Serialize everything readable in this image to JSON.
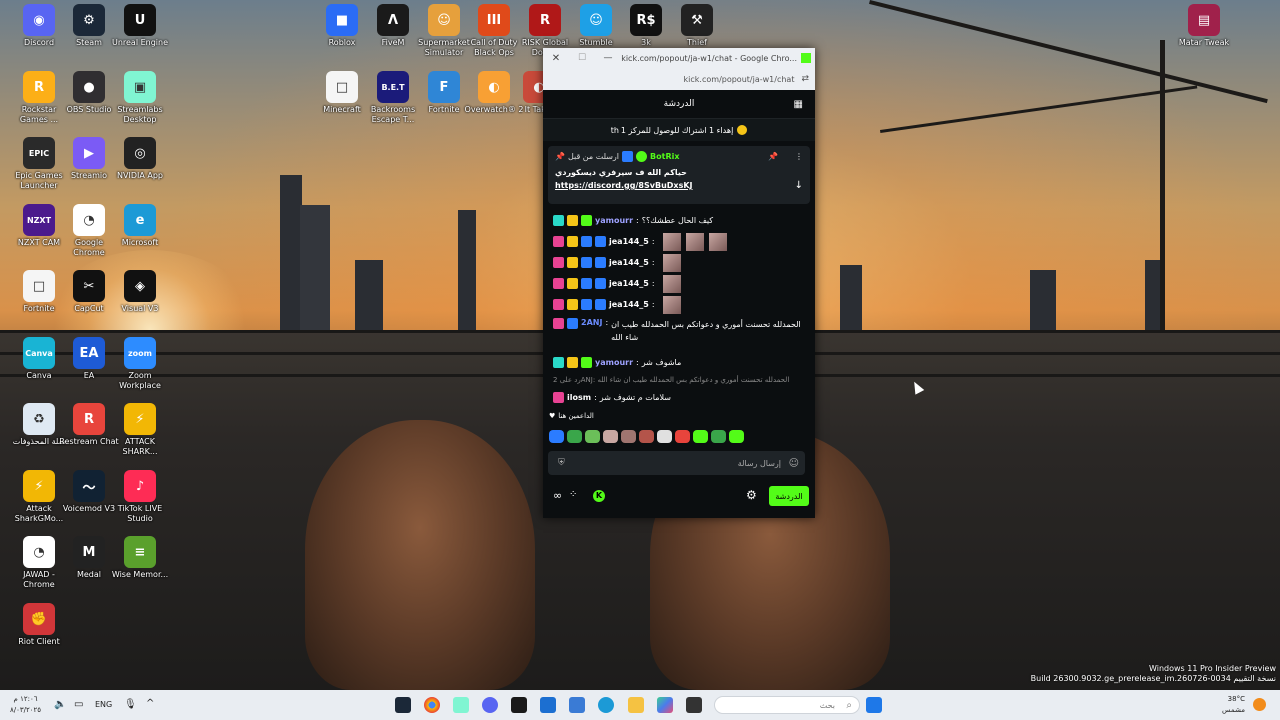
{
  "desktop_icons": [
    {
      "label": "Discord",
      "color": "#5865f2",
      "glyph": "◉"
    },
    {
      "label": "Steam",
      "color": "#1b2838",
      "glyph": "⚙"
    },
    {
      "label": "Unreal Engine",
      "color": "#111111",
      "glyph": "U"
    },
    {
      "label": "Rockstar Games ...",
      "color": "#fcaf17",
      "glyph": "R"
    },
    {
      "label": "OBS Studio",
      "color": "#302e31",
      "glyph": "●"
    },
    {
      "label": "Streamlabs Desktop",
      "color": "#80f5d2",
      "glyph": "▣"
    },
    {
      "label": "Epic Games Launcher",
      "color": "#2a2a2a",
      "glyph": "EPIC"
    },
    {
      "label": "Streamio",
      "color": "#7b5bf5",
      "glyph": "▶"
    },
    {
      "label": "NVIDIA App",
      "color": "#222222",
      "glyph": "◎"
    },
    {
      "label": "NZXT CAM",
      "color": "#4b1a8c",
      "glyph": "NZXT"
    },
    {
      "label": "Google Chrome",
      "color": "#ffffff",
      "glyph": "◔"
    },
    {
      "label": "Microsoft",
      "color": "#1c9ad6",
      "glyph": "e"
    },
    {
      "label": "Fortnite",
      "color": "#f5f5f5",
      "glyph": "□"
    },
    {
      "label": "CapCut",
      "color": "#111111",
      "glyph": "✂"
    },
    {
      "label": "Visual V3",
      "color": "#111111",
      "glyph": "◈"
    },
    {
      "label": "Canva",
      "color": "#19b4d4",
      "glyph": "Canva"
    },
    {
      "label": "EA",
      "color": "#1e5bd6",
      "glyph": "EA"
    },
    {
      "label": "Zoom Workplace",
      "color": "#2d8cff",
      "glyph": "zoom"
    },
    {
      "label": "سلة المحذوفات",
      "color": "#dfe9f3",
      "glyph": "♻"
    },
    {
      "label": "Restream Chat",
      "color": "#e8453c",
      "glyph": "R"
    },
    {
      "label": "ATTACK SHARK...",
      "color": "#f2b705",
      "glyph": "⚡"
    },
    {
      "label": "Attack SharkGMo...",
      "color": "#f2b705",
      "glyph": "⚡"
    },
    {
      "label": "Voicemod V3",
      "color": "#112233",
      "glyph": "〜"
    },
    {
      "label": "TikTok LIVE Studio",
      "color": "#fe2c55",
      "glyph": "♪"
    },
    {
      "label": "JAWAD - Chrome",
      "color": "#ffffff",
      "glyph": "◔"
    },
    {
      "label": "Medal",
      "color": "#222222",
      "glyph": "M"
    },
    {
      "label": "Wise Memor...",
      "color": "#5aa02c",
      "glyph": "≡"
    },
    {
      "label": "Riot Client",
      "color": "#d13639",
      "glyph": "✊"
    },
    {
      "label": "Roblox",
      "color": "#2b6cf5",
      "glyph": "■"
    },
    {
      "label": "FiveM",
      "color": "#1a1a1a",
      "glyph": "Λ"
    },
    {
      "label": "Supermarket Simulator",
      "color": "#e6a03c",
      "glyph": "☺"
    },
    {
      "label": "Call of Duty Black Ops",
      "color": "#e04a1a",
      "glyph": "III"
    },
    {
      "label": "RISK Global Dom...",
      "color": "#b01818",
      "glyph": "R"
    },
    {
      "label": "Stumble",
      "color": "#1ea0e6",
      "glyph": "☺"
    },
    {
      "label": "3k",
      "color": "#111111",
      "glyph": "R$"
    },
    {
      "label": "Thief",
      "color": "#222222",
      "glyph": "⚒"
    },
    {
      "label": "Minecraft",
      "color": "#f5f5f5",
      "glyph": "□"
    },
    {
      "label": "Backrooms Escape T...",
      "color": "#1b1b7a",
      "glyph": "B.E.T"
    },
    {
      "label": "Fortnite",
      "color": "#2f86d6",
      "glyph": "F"
    },
    {
      "label": "Overwatch® 2",
      "color": "#f8a034",
      "glyph": "◐"
    },
    {
      "label": "It Tak...",
      "color": "#c94a3a",
      "glyph": "◐"
    },
    {
      "label": "Matar Tweak",
      "color": "#a0214b",
      "glyph": "▤"
    }
  ],
  "window": {
    "title": "kick.com/popout/ja-w1/chat - Google Chro...",
    "url": "kick.com/popout/ja-w1/chat",
    "header": "الدردشة",
    "goal": "إهداء 1 اشتراك للوصول للمركز 1",
    "goal_prefix": "th",
    "pinned": {
      "by": "ارسلت من قبل",
      "user": "BotRix",
      "text": "حياكم الله ف سيرفري ديسكوردي",
      "link": "https://discord.gg/8SvBuDxsKJ"
    },
    "messages": [
      {
        "user": "yamourr",
        "color": "#9ea2ff",
        "text": "كيف الحال عطشك؟؟",
        "thumbs": 0
      },
      {
        "user": "jea144_5",
        "color": "#ffffff",
        "text": "",
        "thumbs": 3
      },
      {
        "user": "jea144_5",
        "color": "#ffffff",
        "text": "",
        "thumbs": 1
      },
      {
        "user": "jea144_5",
        "color": "#ffffff",
        "text": "",
        "thumbs": 1
      },
      {
        "user": "jea144_5",
        "color": "#ffffff",
        "text": "",
        "thumbs": 1
      },
      {
        "user": "2ANJ",
        "color": "#6b8cff",
        "text": "الحمدلله تحسنت أموري و دعواتكم بس الحمدلله طيب ان شاء الله",
        "thumbs": 0
      },
      {
        "user": "yamourr",
        "color": "#9ea2ff",
        "text": "ماشوف شر",
        "thumbs": 0
      },
      {
        "user": "",
        "color": "#888888",
        "text": "رد على 2ANJ: الحمدلله تحسنت أموري و دعواتكم بس الحمدلله طيب ان شاء الله",
        "thumbs": 0
      },
      {
        "user": "ilosm",
        "color": "#ffffff",
        "text": "سلامات م تشوف شر",
        "thumbs": 0
      }
    ],
    "supporters_label": "الداعمين هنا",
    "composer_placeholder": "إرسال رسالة",
    "send_label": "الدردشة"
  },
  "taskbar": {
    "search_placeholder": "بحث",
    "lang": "ENG",
    "time": "١٢:٠٦ م",
    "date": "٨/٠٣/٢٠٢٥",
    "weather_temp": "38°C",
    "weather_desc": "مشمس"
  },
  "watermark": {
    "line1": "Windows 11 Pro Insider Preview",
    "line2": "Build 26300.9032.ge_prerelease_im.260726-0034 نسخة التقييم"
  },
  "colors": {
    "kick_green": "#53fc18",
    "chat_bg": "#0b0e10",
    "taskbar": "#e9edf2"
  }
}
